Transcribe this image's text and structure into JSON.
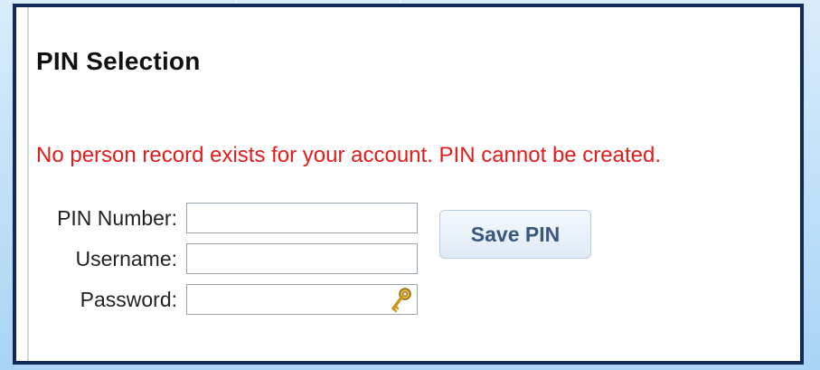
{
  "page": {
    "title": "PIN Selection",
    "error_message": "No person record exists for your account. PIN cannot be created.",
    "error_color": "#e21b1b",
    "frame_color": "#102a5a"
  },
  "form": {
    "pin_number": {
      "label": "PIN Number:",
      "value": "",
      "placeholder": ""
    },
    "username": {
      "label": "Username:",
      "value": "",
      "placeholder": ""
    },
    "password": {
      "label": "Password:",
      "value": "",
      "placeholder": "",
      "icon": "key-icon"
    }
  },
  "actions": {
    "save_label": "Save PIN"
  }
}
